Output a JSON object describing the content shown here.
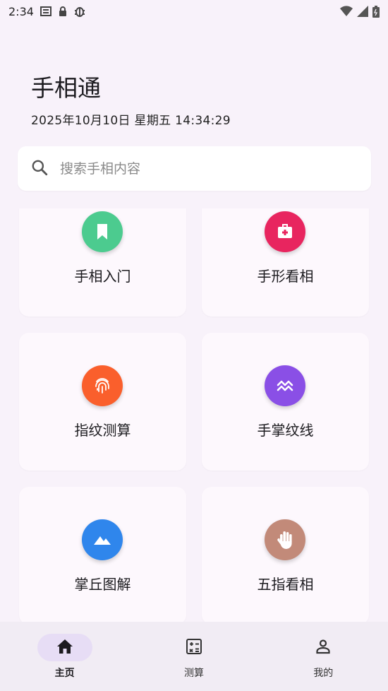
{
  "status_bar": {
    "time": "2:34",
    "icons": [
      "notification-icon",
      "lock-icon",
      "bug-icon",
      "wifi-icon",
      "signal-icon",
      "battery-icon"
    ]
  },
  "header": {
    "title": "手相通",
    "datetime": "2025年10月10日 星期五  14:34:29"
  },
  "search": {
    "placeholder": "搜索手相内容"
  },
  "cards": [
    {
      "label": "手相入门",
      "icon": "bookmark-icon",
      "color": "#4ccb8f"
    },
    {
      "label": "手形看相",
      "icon": "medical-icon",
      "color": "#e8255f"
    },
    {
      "label": "指纹测算",
      "icon": "fingerprint-icon",
      "color": "#fa5f2c"
    },
    {
      "label": "手掌纹线",
      "icon": "palm-lines-icon",
      "color": "#8a4fe6"
    },
    {
      "label": "掌丘图解",
      "icon": "mountains-icon",
      "color": "#2f86ec"
    },
    {
      "label": "五指看相",
      "icon": "hand-icon",
      "color": "#c28a79"
    }
  ],
  "bottom_nav": {
    "items": [
      {
        "label": "主页",
        "icon": "home-icon",
        "active": true
      },
      {
        "label": "测算",
        "icon": "calculator-icon",
        "active": false
      },
      {
        "label": "我的",
        "icon": "person-icon",
        "active": false
      }
    ]
  }
}
